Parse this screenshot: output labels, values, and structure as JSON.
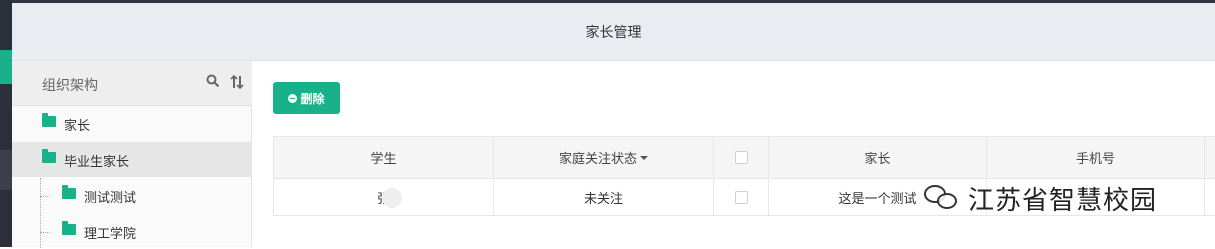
{
  "header": {
    "title": "家长管理"
  },
  "tree": {
    "title": "组织架构",
    "search_icon": "search-icon",
    "sort_icon": "sort-icon",
    "items": [
      {
        "label": "家长",
        "level": 0,
        "icon": "folder-icon",
        "selected": false
      },
      {
        "label": "毕业生家长",
        "level": 0,
        "icon": "folder-open-icon",
        "selected": true
      },
      {
        "label": "测试测试",
        "level": 1,
        "icon": "folder-icon",
        "selected": false
      },
      {
        "label": "理工学院",
        "level": 1,
        "icon": "folder-icon",
        "selected": false
      }
    ]
  },
  "toolbar": {
    "delete_label": "删除"
  },
  "table": {
    "columns": [
      "学生",
      "家庭关注状态",
      "",
      "家长",
      "手机号"
    ],
    "rows": [
      {
        "student": "张",
        "status": "未关注",
        "parent": "这是一个测试",
        "phone": ""
      }
    ]
  },
  "watermark": {
    "text": "江苏省智慧校园"
  },
  "colors": {
    "accent": "#18b18a",
    "header_bg": "#e9edf1",
    "sidebar_dark": "#2b2f3a"
  }
}
